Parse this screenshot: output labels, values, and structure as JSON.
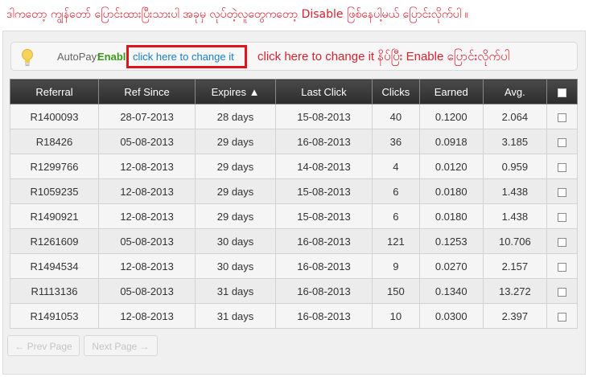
{
  "top_note": "ဒါကတော့ ကျွန်တော် ပြောင်းထားပြီးသားပါ အခုမှ လုပ်တဲ့လူတွေကတော့ Disable ဖြစ်နေပါ့မယ် ပြောင်းလိုက်ပါ ။",
  "autopay": {
    "label": "AutoPay:",
    "status": "Enable",
    "change_link": "click here to change it",
    "annotation": "click here to change it နိပ်ပြီး Enable ပြောင်းလိုက်ပါ"
  },
  "table": {
    "headers": [
      "Referral",
      "Ref Since",
      "Expires ▲",
      "Last Click",
      "Clicks",
      "Earned",
      "Avg."
    ],
    "rows": [
      [
        "R1400093",
        "28-07-2013",
        "28 days",
        "15-08-2013",
        "40",
        "0.1200",
        "2.064"
      ],
      [
        "R18426",
        "05-08-2013",
        "29 days",
        "16-08-2013",
        "36",
        "0.0918",
        "3.185"
      ],
      [
        "R1299766",
        "12-08-2013",
        "29 days",
        "14-08-2013",
        "4",
        "0.0120",
        "0.959"
      ],
      [
        "R1059235",
        "12-08-2013",
        "29 days",
        "15-08-2013",
        "6",
        "0.0180",
        "1.438"
      ],
      [
        "R1490921",
        "12-08-2013",
        "29 days",
        "15-08-2013",
        "6",
        "0.0180",
        "1.438"
      ],
      [
        "R1261609",
        "05-08-2013",
        "30 days",
        "16-08-2013",
        "121",
        "0.1253",
        "10.706"
      ],
      [
        "R1494534",
        "12-08-2013",
        "30 days",
        "16-08-2013",
        "9",
        "0.0270",
        "2.157"
      ],
      [
        "R1113136",
        "05-08-2013",
        "31 days",
        "16-08-2013",
        "150",
        "0.1340",
        "13.272"
      ],
      [
        "R1491053",
        "12-08-2013",
        "31 days",
        "16-08-2013",
        "10",
        "0.0300",
        "2.397"
      ]
    ]
  },
  "pager": {
    "prev": "← Prev Page",
    "next": "Next Page →"
  },
  "colors": {
    "annotation_red": "#d8212f",
    "enable_green": "#3a9a1a",
    "link_blue": "#1a7ec8",
    "header_dark": "#333333"
  }
}
